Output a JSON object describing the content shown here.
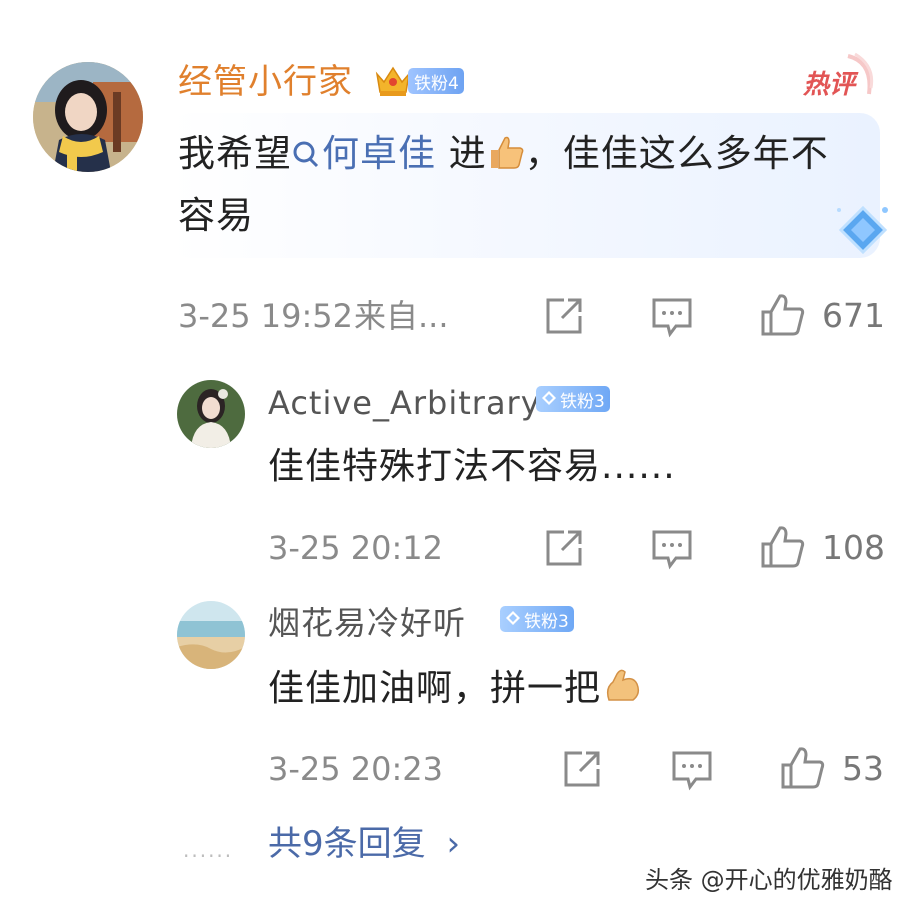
{
  "main_comment": {
    "username": "经管小行家",
    "badge": "铁粉4",
    "hot_tag": "热评",
    "content_prefix": "我希望",
    "mention": "何卓佳",
    "content_mid": " 进",
    "content_suffix": "，佳佳这么多年不容易",
    "timestamp": "3-25 19:52",
    "source": "来自...",
    "like_count": "671"
  },
  "replies": [
    {
      "username": "Active_Arbitrary",
      "badge": "铁粉3",
      "content": "佳佳特殊打法不容易......",
      "timestamp": "3-25 20:12",
      "like_count": "108"
    },
    {
      "username": "烟花易冷好听",
      "badge": "铁粉3",
      "content": "佳佳加油啊，拼一把",
      "timestamp": "3-25 20:23",
      "like_count": "53"
    }
  ],
  "more_replies": {
    "dots": "......",
    "label": "共9条回复",
    "arrow": "›"
  },
  "watermark": "头条 @开心的优雅奶酪",
  "icons": [
    "crown-icon",
    "gem-icon",
    "search-mention-icon",
    "thumbs-up-emoji",
    "share-icon",
    "comment-icon",
    "like-icon",
    "flex-arm-emoji",
    "diamond-decoration"
  ],
  "colors": {
    "username_main": "#e0802d",
    "link": "#4a6fb3",
    "meta": "#8a8a8a",
    "hot_tag": "#e25555"
  }
}
